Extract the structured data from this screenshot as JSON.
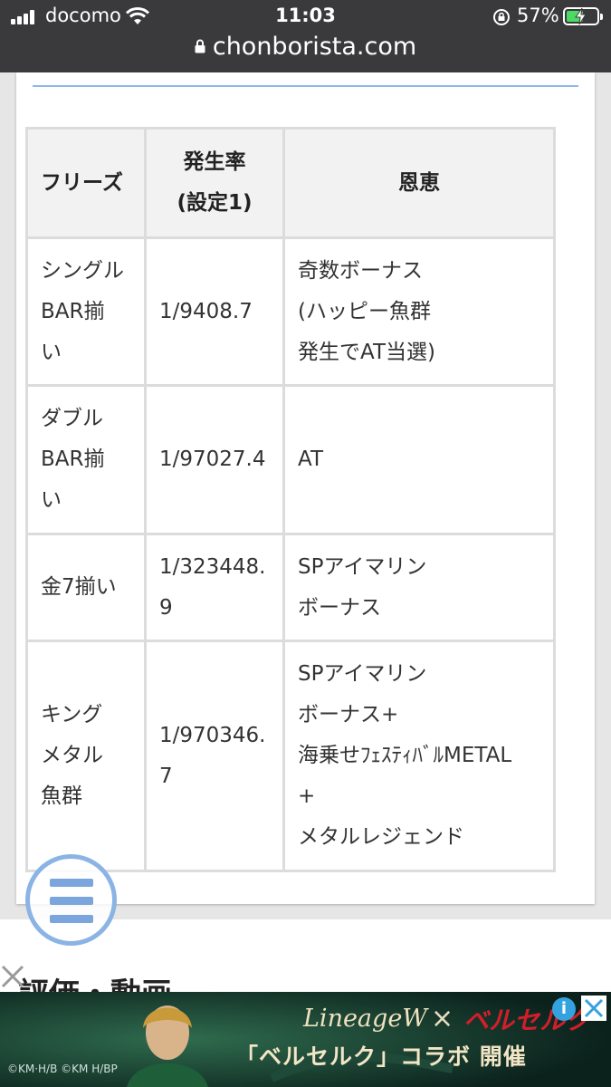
{
  "status_bar": {
    "carrier": "docomo",
    "time": "11:03",
    "battery_percent": "57%",
    "battery_level": 0.57
  },
  "url_bar": {
    "domain": "chonborista.com"
  },
  "table": {
    "headers": {
      "freeze": "フリーズ",
      "rate_line1": "発生率",
      "rate_line2": "(設定1)",
      "benefit": "恩恵"
    },
    "rows": [
      {
        "name": [
          "シングル",
          "BAR揃",
          "い"
        ],
        "rate": [
          "1/9408.7"
        ],
        "benefit": [
          "奇数ボーナス",
          "(ハッピー魚群",
          "発生でAT当選)"
        ]
      },
      {
        "name": [
          "ダブル",
          "BAR揃",
          "い"
        ],
        "rate": [
          "1/97027.4"
        ],
        "benefit": [
          "AT"
        ]
      },
      {
        "name": [
          "金7揃い"
        ],
        "rate": [
          "1/323448.",
          "9"
        ],
        "benefit": [
          "SPアイマリン",
          "ボーナス"
        ]
      },
      {
        "name": [
          "キング",
          "メタル",
          "魚群"
        ],
        "rate": [
          "1/970346.",
          "7"
        ],
        "benefit": [
          "SPアイマリン",
          "ボーナス+",
          "海乗せﾌｪｽﾃｨﾊﾞﾙMETAL",
          "+",
          "メタルレジェンド"
        ]
      }
    ]
  },
  "section_heading": "評価・動画",
  "ad": {
    "logo_text": "LineageW",
    "cross": "×",
    "brand2": "ベルセルク",
    "headline": "「ベルセルク」コラボ 開催",
    "copyright": "©KM·H/B ©KM H/BP",
    "info_label": "i"
  },
  "colors": {
    "accent_blue": "#8bb4e4",
    "battery_green": "#4cd964",
    "statusbar_bg": "#3a3a3c"
  }
}
